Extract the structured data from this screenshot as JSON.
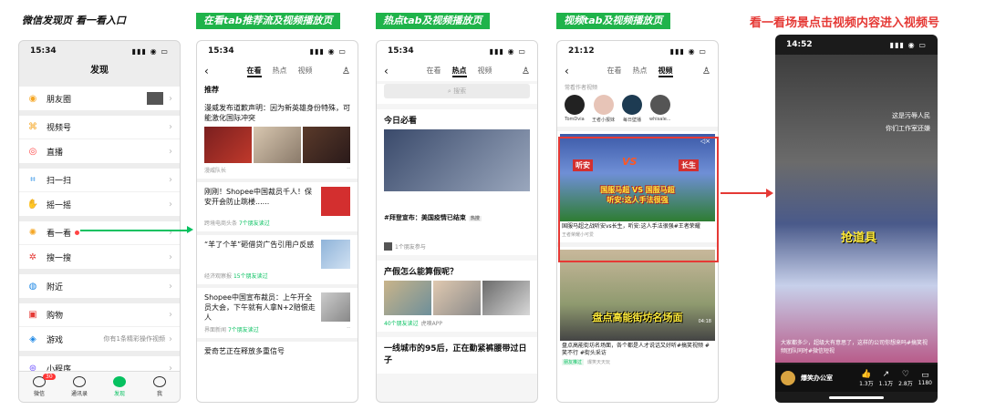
{
  "captions": {
    "c1": "微信发现页 看一看入口",
    "c2": "在看tab推荐流及视频播放页",
    "c3": "热点tab及视频播放页",
    "c4": "视频tab及视频播放页",
    "c5": "看一看场景点击视频内容进入视频号"
  },
  "phone1": {
    "time": "15:34",
    "title": "发现",
    "groups": [
      [
        {
          "label": "朋友圈",
          "icon": "moments-icon"
        }
      ],
      [
        {
          "label": "视频号",
          "icon": "channels-icon"
        },
        {
          "label": "直播",
          "icon": "live-icon"
        }
      ],
      [
        {
          "label": "扫一扫",
          "icon": "scan-icon"
        },
        {
          "label": "摇一摇",
          "icon": "shake-icon"
        }
      ],
      [
        {
          "label": "看一看",
          "icon": "top-stories-icon"
        },
        {
          "label": "搜一搜",
          "icon": "search-icon"
        }
      ],
      [
        {
          "label": "附近",
          "icon": "nearby-icon"
        }
      ],
      [
        {
          "label": "购物",
          "icon": "shop-icon"
        },
        {
          "label": "游戏",
          "icon": "game-icon"
        }
      ],
      [
        {
          "label": "小程序",
          "icon": "miniprogram-icon"
        }
      ]
    ],
    "game_aux": "你有1条精彩操作视频",
    "tabs": [
      {
        "label": "微信",
        "badge": "30"
      },
      {
        "label": "通讯录"
      },
      {
        "label": "发现",
        "active": true
      },
      {
        "label": "我"
      }
    ]
  },
  "phone2": {
    "time": "15:34",
    "tabs": [
      "在看",
      "热点",
      "视频"
    ],
    "section": "推荐",
    "articles": [
      {
        "title": "漫威发布道歉声明：因为新英雄身份特殊，可能激化国际冲突",
        "meta": "漫威队长"
      },
      {
        "title": "刚刚！Shopee中国裁员千人！保安开会防止跳楼......",
        "meta": "跨境电商头条",
        "friends": "7个朋友读过"
      },
      {
        "title": "“羊了个羊”砸借贷广告引用户反感",
        "meta": "经济观察报",
        "friends": "15个朋友读过"
      },
      {
        "title": "Shopee中国宣布裁员：上午开全员大会，下午就有人拿N+2赔偿走人",
        "meta": "界面新闻",
        "friends": "7个朋友读过"
      },
      {
        "title": "爱奇艺正在释放多重信号"
      }
    ]
  },
  "phone3": {
    "time": "15:34",
    "tabs": [
      "在看",
      "热点",
      "视频"
    ],
    "search_placeholder": "搜索",
    "today": "今日必看",
    "headline": "#拜登宣布：美国疫情已结束",
    "headline_tag": "热搜",
    "participants": "1个朋友参与",
    "q2": "产假怎么能算假呢？",
    "q2_friends": "40个朋友读过",
    "q2_src": "虎嗅APP",
    "q3": "一线城市的95后，正在勤紧裤腰带过日子"
  },
  "phone4": {
    "time": "21:12",
    "tabs": [
      "在看",
      "热点",
      "视频"
    ],
    "follow_label": "常看作者视频",
    "authors": [
      {
        "name": "TomDvia"
      },
      {
        "name": "王者小报妹"
      },
      {
        "name": "每日壁播"
      },
      {
        "name": "whisale..."
      }
    ],
    "video1": {
      "p1": "听安",
      "p2": "长生",
      "hl1": "国服马超 VS 国服马超",
      "hl2": "听安:这人手法很强",
      "title": "国服马超之战听安vs长生，听安:这人手法很强#王者荣耀",
      "src": "王者荣耀小可爱"
    },
    "video2": {
      "hl": "盘点高能街坊名场面",
      "duration": "04:18",
      "title": "盘点高能街坊名场面，各个都是人才说话又好听#搞笑视频 #笑不行 #街头采访",
      "friends": "朋友推过",
      "src": "爆笑天天玩"
    }
  },
  "phone5": {
    "time": "14:52",
    "overlay1": "这是污辱人民",
    "overlay2": "你们工作室还嫌",
    "grab": "抢道具",
    "desc": "大家都多少，超级大有意思了，这样的公司你想来吗#搞笑视频团队同时#微信短视",
    "author": "爆笑办公室",
    "stats": [
      {
        "label": "1.3万",
        "icon": "like-icon"
      },
      {
        "label": "1.1万",
        "icon": "share-icon"
      },
      {
        "label": "2.8万",
        "icon": "heart-icon"
      },
      {
        "label": "1180",
        "icon": "comment-icon"
      }
    ]
  }
}
